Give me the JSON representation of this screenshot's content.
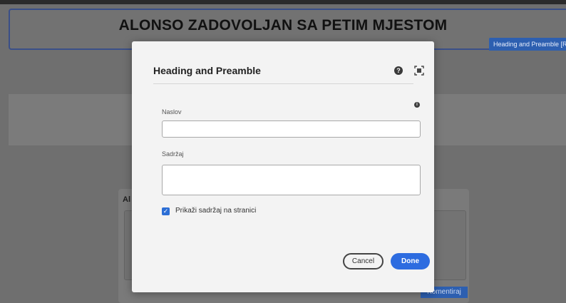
{
  "background": {
    "heading_title": "ALONSO ZADOVOLJAN SA PETIM MJESTOM",
    "component_tag": "Heading and Preamble [Ro",
    "comment_label": "Al",
    "comment_button": "Komentiraj"
  },
  "dialog": {
    "title": "Heading and Preamble",
    "help_icon": "?",
    "info_icon": "i",
    "fields": {
      "naslov_label": "Naslov",
      "naslov_value": "",
      "sadrzaj_label": "Sadržaj",
      "sadrzaj_value": ""
    },
    "checkbox": {
      "label": "Prikaži sadržaj na stranici",
      "checked": true,
      "mark": "✓"
    },
    "buttons": {
      "cancel": "Cancel",
      "done": "Done"
    }
  },
  "colors": {
    "accent": "#2d6ce0",
    "overlay": "#6f6f6f"
  }
}
